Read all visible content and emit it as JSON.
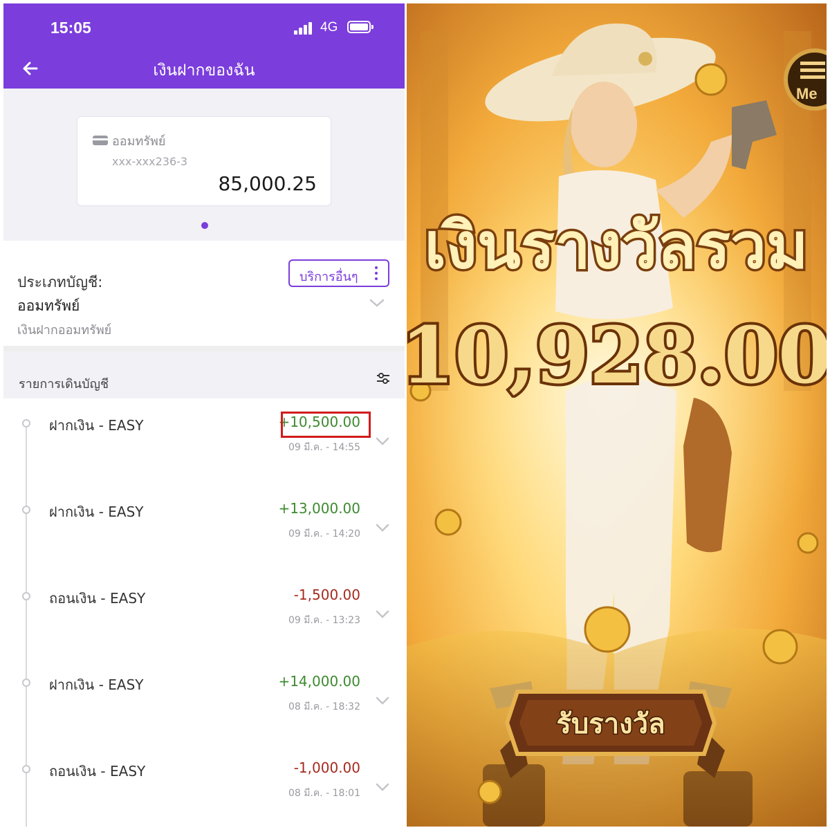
{
  "status_bar": {
    "time": "15:05",
    "network": "4G"
  },
  "app_bar": {
    "title": "เงินฝากของฉัน"
  },
  "account_card": {
    "type": "ออมทรัพย์",
    "number": "xxx-xxx236-3",
    "balance": "85,000.25"
  },
  "account_type": {
    "label": "ประเภทบัญชี:",
    "value": "ออมทรัพย์",
    "sub": "เงินฝากออมทรัพย์",
    "other_services_label": "บริการอื่นๆ"
  },
  "transactions": {
    "header": "รายการเดินบัญชี",
    "items": [
      {
        "desc": "ฝากเงิน - EASY",
        "amount": "+10,500.00",
        "date": "09 มี.ค. - 14:55",
        "kind": "pos"
      },
      {
        "desc": "ฝากเงิน - EASY",
        "amount": "+13,000.00",
        "date": "09 มี.ค. - 14:20",
        "kind": "pos"
      },
      {
        "desc": "ถอนเงิน - EASY",
        "amount": "-1,500.00",
        "date": "09 มี.ค. - 13:23",
        "kind": "neg"
      },
      {
        "desc": "ฝากเงิน - EASY",
        "amount": "+14,000.00",
        "date": "08 มี.ค. - 18:32",
        "kind": "pos"
      },
      {
        "desc": "ถอนเงิน - EASY",
        "amount": "-1,000.00",
        "date": "08 มี.ค. - 18:01",
        "kind": "neg"
      }
    ]
  },
  "colors": {
    "brand_purple": "#7b3ddc",
    "deposit_green": "#3d8a2f",
    "withdraw_red": "#a52a1f",
    "highlight_red": "#d21b1b",
    "gold": "#f2b13a"
  },
  "game": {
    "prize_title": "เงินรางวัลรวม",
    "prize_amount": "10,928.00",
    "claim_button_label": "รับรางวัล",
    "menu_label": "Me"
  }
}
